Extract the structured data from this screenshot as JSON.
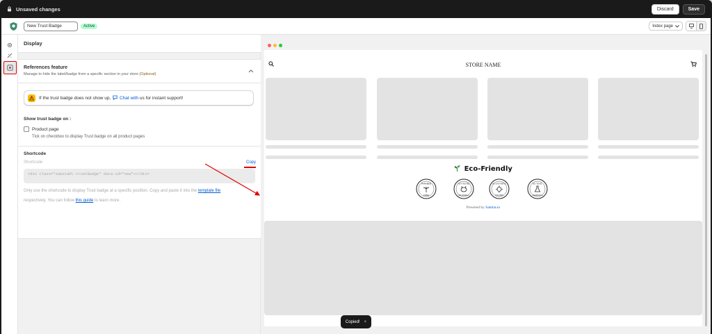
{
  "topbar": {
    "title": "Unsaved changes",
    "discard_label": "Discard",
    "save_label": "Save"
  },
  "appbar": {
    "badge_name_value": "New Trust Badge",
    "status_badge": "Active",
    "page_select": "Index page"
  },
  "settings": {
    "panel_title": "Display",
    "references": {
      "title": "References feature",
      "subtitle": "Manage to hide the label/badge from a specific section in your store",
      "optional": "(Optional)"
    },
    "alert": {
      "text_before": "If the trust badge does not show up,",
      "link": "Chat with",
      "text_after": "us for instant support!"
    },
    "show_on": {
      "title": "Show trust badge on :",
      "checkbox_label": "Product page",
      "help": "Tick on checkbox to display Trust badge on all product pages"
    },
    "shortcode": {
      "title": "Shortcode",
      "label": "Shortcode",
      "copy": "Copy",
      "code": "<div class=\"samitaPL-trustBadge\" data-id=\"new\"></div>",
      "help1_before": "Only use the shortcode to display Trust badge at a specific position. Copy and paste it into the",
      "help1_link": "template file",
      "help2_before": "respectively. You can follow",
      "help2_link": "this guide",
      "help2_after": "to learn more."
    }
  },
  "preview": {
    "store_name": "STORE NAME",
    "eco_title": "Eco-Friendly",
    "badges": [
      "PARABEN FREE",
      "NOT TESTED ON ANIMALS",
      "NO SYNTHETIC COLORS",
      "NO TOXIC CHEMICALS"
    ],
    "powered_by": "Powered by",
    "powered_link": "Samita.io"
  },
  "toast": {
    "text": "Copied!",
    "close": "×"
  },
  "colors": {
    "accent_red": "#e00000",
    "link_blue": "#005bd3",
    "active_badge_bg": "#b4fed2",
    "warning": "#ffb800"
  }
}
